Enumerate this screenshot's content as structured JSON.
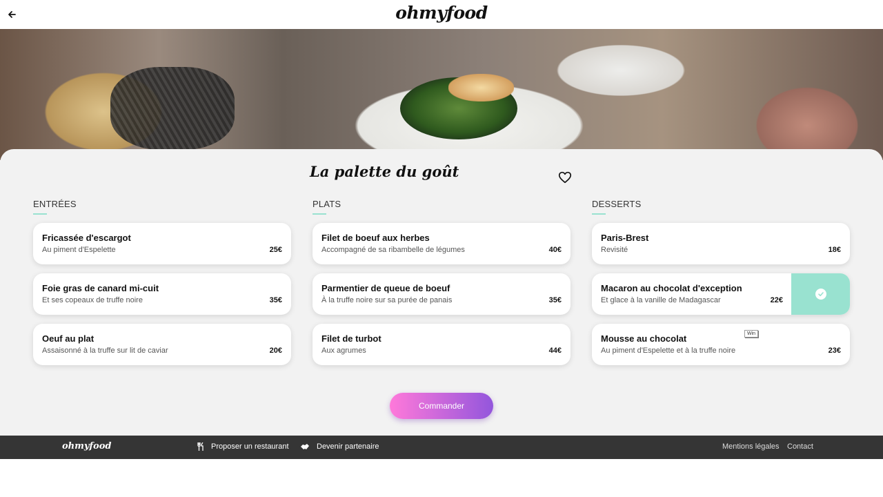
{
  "header": {
    "logo": "ohmyfood"
  },
  "restaurant": {
    "title": "La palette du goût"
  },
  "menu": {
    "entrees": {
      "title": "ENTRÉES",
      "items": [
        {
          "name": "Fricassée d'escargot",
          "desc": "Au piment d'Espelette",
          "price": "25€"
        },
        {
          "name": "Foie gras de canard mi-cuit",
          "desc": "Et ses copeaux de truffe noire",
          "price": "35€"
        },
        {
          "name": "Oeuf au plat",
          "desc": "Assaisonné à la truffe sur lit de caviar",
          "price": "20€"
        }
      ]
    },
    "plats": {
      "title": "PLATS",
      "items": [
        {
          "name": "Filet de boeuf aux herbes",
          "desc": "Accompagné de sa ribambelle de légumes",
          "price": "40€"
        },
        {
          "name": "Parmentier de queue de boeuf",
          "desc": "À la truffe noire sur sa purée de panais",
          "price": "35€"
        },
        {
          "name": "Filet de turbot",
          "desc": "Aux agrumes",
          "price": "44€"
        }
      ]
    },
    "desserts": {
      "title": "DESSERTS",
      "items": [
        {
          "name": "Paris-Brest",
          "desc": "Revisité",
          "price": "18€"
        },
        {
          "name": "Macaron au chocolat d'exception",
          "desc": "Et glace à la vanille de Madagascar",
          "price": "22€",
          "selected": true
        },
        {
          "name": "Mousse au chocolat",
          "desc": "Au piment d'Espelette et à la truffe noire",
          "price": "23€",
          "badge": "Win"
        }
      ]
    }
  },
  "order_button": "Commander",
  "footer": {
    "logo": "ohmyfood",
    "propose": "Proposer un restaurant",
    "partner": "Devenir partenaire",
    "legal": "Mentions légales",
    "contact": "Contact"
  },
  "colors": {
    "accent": "#99e2d0",
    "button_start": "#ff79da",
    "button_end": "#9356dc",
    "footer_bg": "#353535",
    "main_bg": "#f2f2f2"
  }
}
